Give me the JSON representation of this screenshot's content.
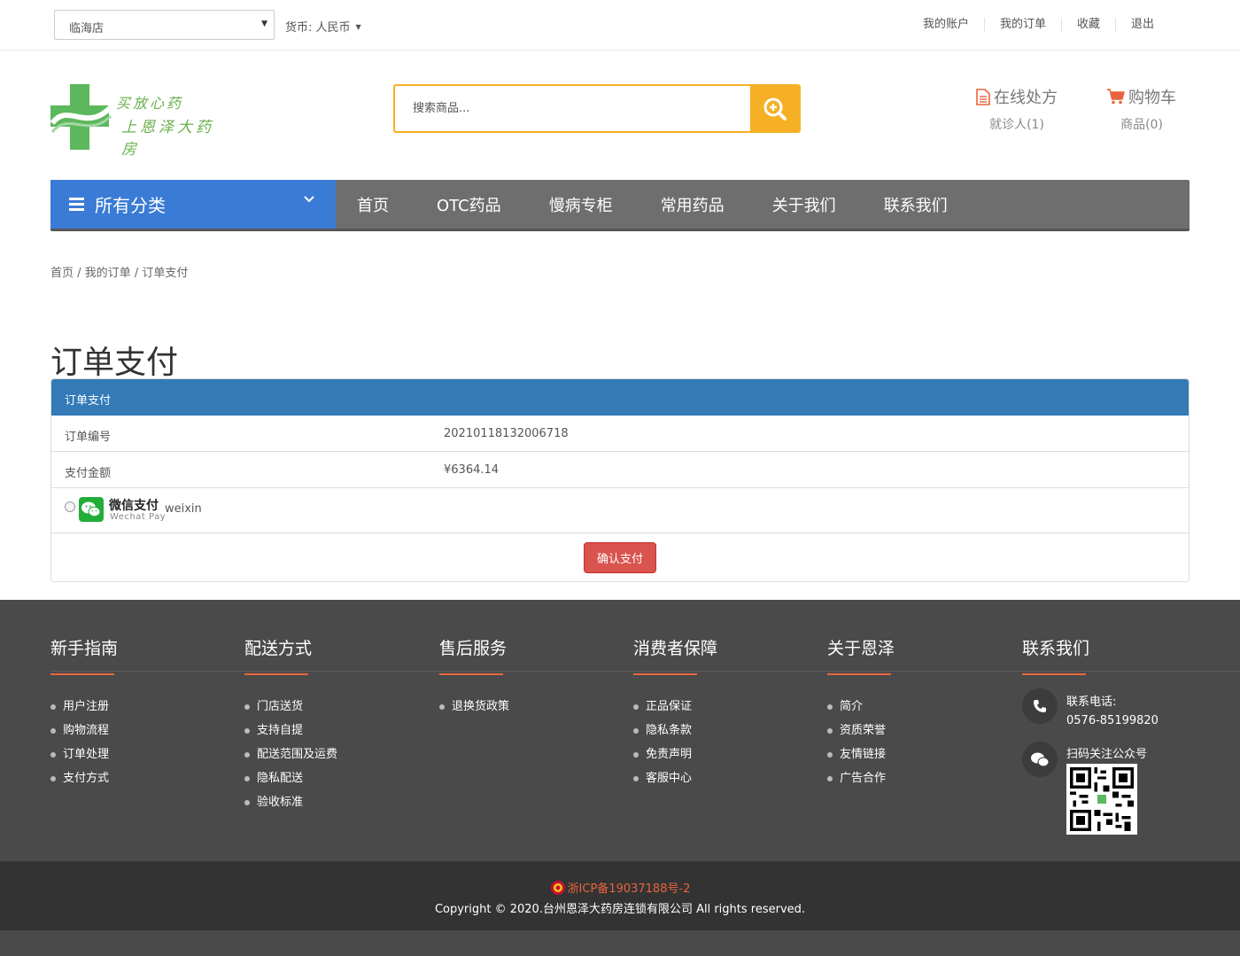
{
  "topbar": {
    "store": "临海店",
    "currency": "货币: 人民币",
    "links": [
      "我的账户",
      "我的订单",
      "收藏",
      "退出"
    ]
  },
  "header": {
    "logo_line1": "买放心药",
    "logo_line2": "上恩泽大药房",
    "search_placeholder": "搜索商品...",
    "prescription_title": "在线处方",
    "prescription_sub": "就诊人(1)",
    "cart_title": "购物车",
    "cart_sub": "商品(0)"
  },
  "nav": {
    "category_label": "所有分类",
    "links": [
      "首页",
      "OTC药品",
      "慢病专柜",
      "常用药品",
      "关于我们",
      "联系我们"
    ]
  },
  "breadcrumb": [
    "首页",
    "我的订单",
    "订单支付"
  ],
  "page_title": "订单支付",
  "panel": {
    "heading": "订单支付",
    "order_no_label": "订单编号",
    "order_no": "20210118132006718",
    "amount_label": "支付金额",
    "amount": "¥6364.14",
    "pay_title": "微信支付",
    "pay_sub": "Wechat Pay",
    "pay_code": "weixin",
    "confirm": "确认支付"
  },
  "footer": {
    "cols": [
      {
        "title": "新手指南",
        "items": [
          "用户注册",
          "购物流程",
          "订单处理",
          "支付方式"
        ]
      },
      {
        "title": "配送方式",
        "items": [
          "门店送货",
          "支持自提",
          "配送范围及运费",
          "隐私配送",
          "验收标准"
        ]
      },
      {
        "title": "售后服务",
        "items": [
          "退换货政策"
        ]
      },
      {
        "title": "消费者保障",
        "items": [
          "正品保证",
          "隐私条款",
          "免责声明",
          "客服中心"
        ]
      },
      {
        "title": "关于恩泽",
        "items": [
          "简介",
          "资质荣誉",
          "友情链接",
          "广告合作"
        ]
      }
    ],
    "contact_title": "联系我们",
    "phone_label": "联系电话:",
    "phone": "0576-85199820",
    "wechat_label": "扫码关注公众号",
    "icp": "浙ICP备19037188号-2",
    "copyright": "Copyright © 2020.台州恩泽大药房连锁有限公司 All rights reserved."
  },
  "colors": {
    "accent_blue": "#3a7bd5",
    "search_orange": "#f5b025",
    "panel_blue": "#337ab7",
    "confirm_red": "#d9534f",
    "footer_orange": "#e8643c"
  }
}
